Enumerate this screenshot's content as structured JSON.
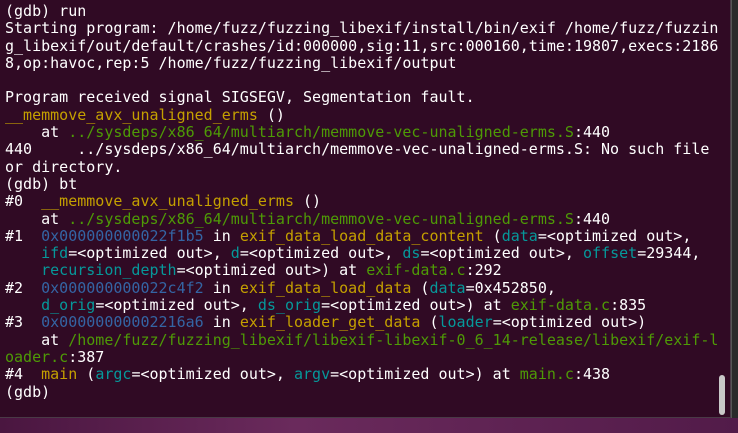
{
  "terminal": {
    "lines": [
      [
        [
          "(gdb) run",
          "w"
        ]
      ],
      [
        [
          "Starting program: /home/fuzz/fuzzing_libexif/install/bin/exif /home/fuzz/fuzzin",
          "w"
        ]
      ],
      [
        [
          "g_libexif/out/default/crashes/id:000000,sig:11,src:000160,time:19807,execs:2186",
          "w"
        ]
      ],
      [
        [
          "8,op:havoc,rep:5 /home/fuzz/fuzzing_libexif/output",
          "w"
        ]
      ],
      [
        [
          "",
          "w"
        ]
      ],
      [
        [
          "Program received signal SIGSEGV, Segmentation fault.",
          "w"
        ]
      ],
      [
        [
          "__memmove_avx_unaligned_erms",
          "y"
        ],
        [
          " ()",
          "w"
        ]
      ],
      [
        [
          "    at ",
          "w"
        ],
        [
          "../sysdeps/x86_64/multiarch/memmove-vec-unaligned-erms.S",
          "g"
        ],
        [
          ":440",
          "w"
        ]
      ],
      [
        [
          "440     ../sysdeps/x86_64/multiarch/memmove-vec-unaligned-erms.S: No such file",
          "w"
        ]
      ],
      [
        [
          "or directory.",
          "w"
        ]
      ],
      [
        [
          "(gdb) bt",
          "w"
        ]
      ],
      [
        [
          "#0  ",
          "w"
        ],
        [
          "__memmove_avx_unaligned_erms",
          "y"
        ],
        [
          " ()",
          "w"
        ]
      ],
      [
        [
          "    at ",
          "w"
        ],
        [
          "../sysdeps/x86_64/multiarch/memmove-vec-unaligned-erms.S",
          "g"
        ],
        [
          ":440",
          "w"
        ]
      ],
      [
        [
          "#1  ",
          "w"
        ],
        [
          "0x000000000022f1b5",
          "b"
        ],
        [
          " in ",
          "w"
        ],
        [
          "exif_data_load_data_content",
          "y"
        ],
        [
          " (",
          "w"
        ],
        [
          "data",
          "c"
        ],
        [
          "=<optimized out>,",
          "w"
        ]
      ],
      [
        [
          "    ",
          "w"
        ],
        [
          "ifd",
          "c"
        ],
        [
          "=<optimized out>, ",
          "w"
        ],
        [
          "d",
          "c"
        ],
        [
          "=<optimized out>, ",
          "w"
        ],
        [
          "ds",
          "c"
        ],
        [
          "=<optimized out>, ",
          "w"
        ],
        [
          "offset",
          "c"
        ],
        [
          "=29344,",
          "w"
        ]
      ],
      [
        [
          "    ",
          "w"
        ],
        [
          "recursion_depth",
          "c"
        ],
        [
          "=<optimized out>) at ",
          "w"
        ],
        [
          "exif-data.c",
          "g"
        ],
        [
          ":292",
          "w"
        ]
      ],
      [
        [
          "#2  ",
          "w"
        ],
        [
          "0x000000000022c4f2",
          "b"
        ],
        [
          " in ",
          "w"
        ],
        [
          "exif_data_load_data",
          "y"
        ],
        [
          " (",
          "w"
        ],
        [
          "data",
          "c"
        ],
        [
          "=0x452850,",
          "w"
        ]
      ],
      [
        [
          "    ",
          "w"
        ],
        [
          "d_orig",
          "c"
        ],
        [
          "=<optimized out>, ",
          "w"
        ],
        [
          "ds_orig",
          "c"
        ],
        [
          "=<optimized out>) at ",
          "w"
        ],
        [
          "exif-data.c",
          "g"
        ],
        [
          ":835",
          "w"
        ]
      ],
      [
        [
          "#3  ",
          "w"
        ],
        [
          "0x00000000002216a6",
          "b"
        ],
        [
          " in ",
          "w"
        ],
        [
          "exif_loader_get_data",
          "y"
        ],
        [
          " (",
          "w"
        ],
        [
          "loader",
          "c"
        ],
        [
          "=<optimized out>)",
          "w"
        ]
      ],
      [
        [
          "    at ",
          "w"
        ],
        [
          "/home/fuzz/fuzzing_libexif/libexif-libexif-0_6_14-release/libexif/exif-l",
          "g"
        ]
      ],
      [
        [
          "oader.c",
          "g"
        ],
        [
          ":387",
          "w"
        ]
      ],
      [
        [
          "#4  ",
          "w"
        ],
        [
          "main",
          "y"
        ],
        [
          " (",
          "w"
        ],
        [
          "argc",
          "c"
        ],
        [
          "=<optimized out>, ",
          "w"
        ],
        [
          "argv",
          "c"
        ],
        [
          "=<optimized out>) at ",
          "w"
        ],
        [
          "main.c",
          "g"
        ],
        [
          ":438",
          "w"
        ]
      ],
      [
        [
          "(gdb)",
          "w"
        ]
      ]
    ]
  }
}
